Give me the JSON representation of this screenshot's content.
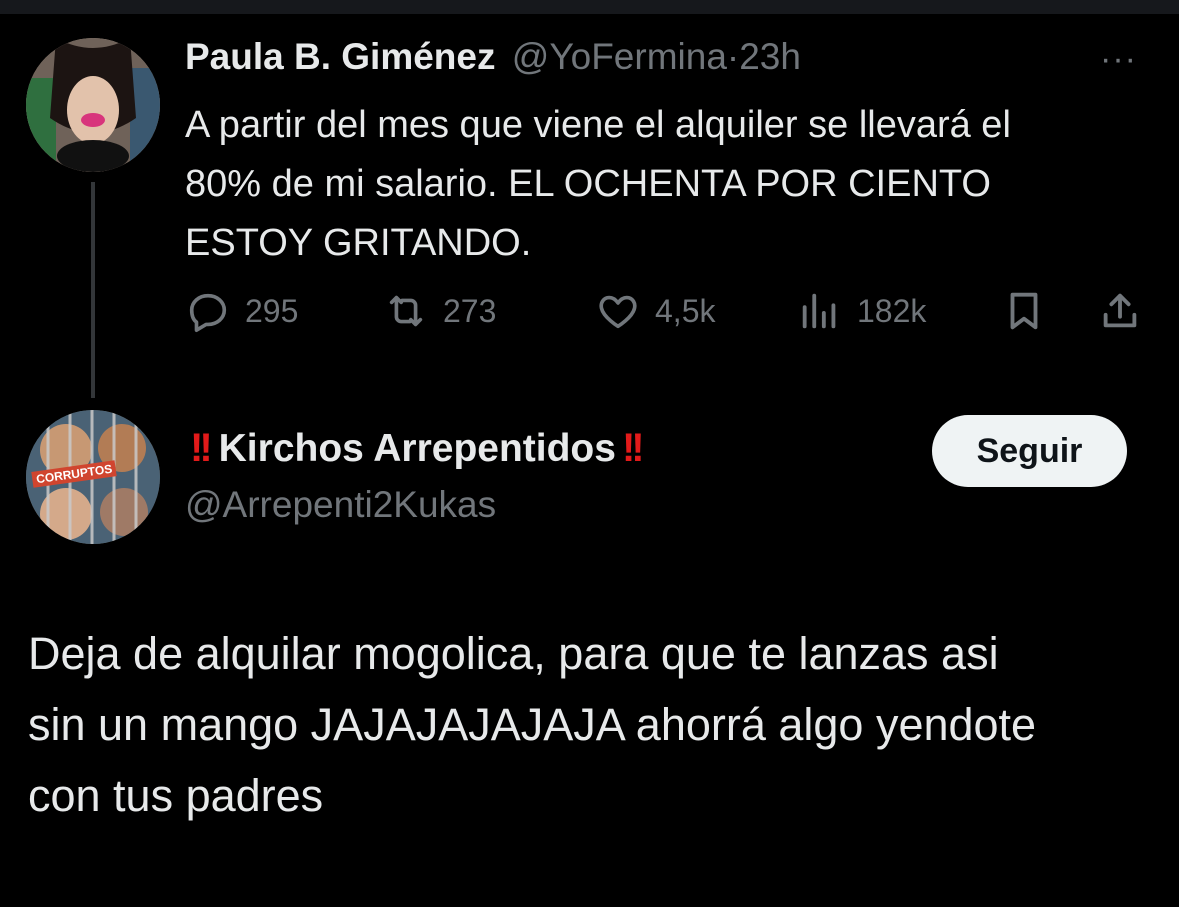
{
  "original_tweet": {
    "display_name": "Paula B. Giménez",
    "handle": "@YoFermina",
    "separator": "·",
    "time": "23h",
    "text_lines": [
      "A partir del mes que viene el alquiler se llevará el",
      "80% de mi salario. EL OCHENTA POR CIENTO",
      "ESTOY GRITANDO."
    ],
    "stats": {
      "replies": "295",
      "retweets": "273",
      "likes": "4,5k",
      "views": "182k"
    },
    "more_label": "···"
  },
  "reply_tweet": {
    "name_prefix_emoji": "!!",
    "display_name": "Kirchos Arrepentidos",
    "name_suffix_emoji": "!!",
    "handle": "@Arrepenti2Kukas",
    "follow_label": "Seguir",
    "avatar_text": "CORRUPTOS",
    "text_lines": [
      "Deja de alquilar mogolica, para que te lanzas asi",
      "sin un mango JAJAJAJAJAJA ahorrá algo yendote",
      "con tus padres"
    ]
  },
  "colors": {
    "background": "#000000",
    "text": "#e7e9ea",
    "muted": "#71767b",
    "thread_line": "#333639",
    "button_bg": "#eff3f4",
    "emoji_red": "#e21a1a"
  },
  "icons": [
    "reply-icon",
    "retweet-icon",
    "like-icon",
    "views-icon",
    "bookmark-icon",
    "share-icon",
    "more-icon"
  ]
}
